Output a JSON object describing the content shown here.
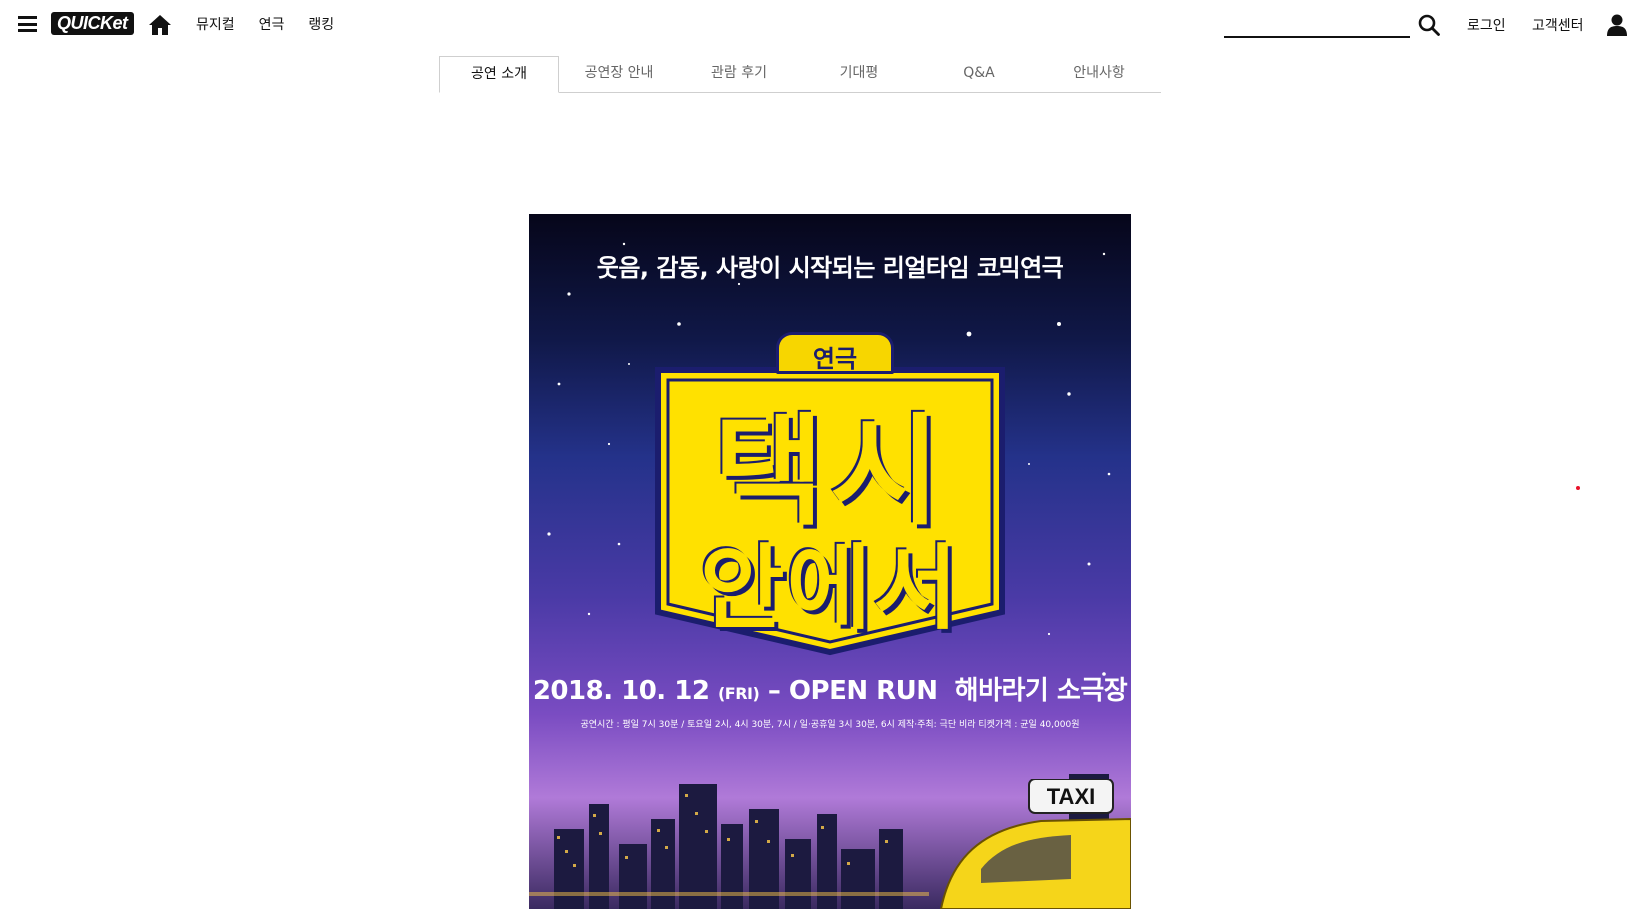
{
  "header": {
    "logo": "QUICKet",
    "nav": [
      "뮤지컬",
      "연극",
      "랭킹"
    ],
    "search": {
      "value": "",
      "placeholder": ""
    },
    "login": "로그인",
    "customer_center": "고객센터"
  },
  "tabs": [
    {
      "label": "공연 소개",
      "active": true
    },
    {
      "label": "공연장 안내",
      "active": false
    },
    {
      "label": "관람 후기",
      "active": false
    },
    {
      "label": "기대평",
      "active": false
    },
    {
      "label": "Q&A",
      "active": false
    },
    {
      "label": "안내사항",
      "active": false
    }
  ],
  "poster": {
    "tagline": "웃음, 감동, 사랑이 시작되는 리얼타임 코믹연극",
    "genre": "연극",
    "title_line1": "택시",
    "title_line2": "안에서",
    "date": "2018. 10. 12",
    "day": "(FRI)",
    "run": "– OPEN RUN",
    "venue": "해바라기 소극장",
    "info": "공연시간 : 평일 7시 30분 / 토요일 2시, 4시 30분, 7시 / 일·공휴일 3시 30분, 6시   제작·주최: 극단 비라   티켓가격 : 균일 40,000원",
    "taxi_sign": "TAXI"
  },
  "colors": {
    "accent_yellow": "#ffe100",
    "sign_navy": "#1b1d6e",
    "tab_border": "#cfcfcf",
    "red_dot": "#e8122a"
  }
}
